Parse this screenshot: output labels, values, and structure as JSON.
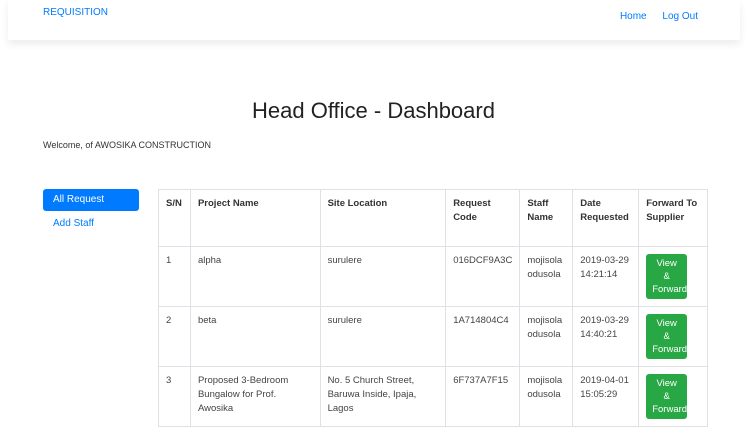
{
  "navbar": {
    "brand": "REQUISITION",
    "links": [
      "Home",
      "Log Out"
    ]
  },
  "page": {
    "title": "Head Office - Dashboard",
    "welcome": "Welcome, of AWOSIKA CONSTRUCTION"
  },
  "sidebar": {
    "items": [
      {
        "label": "All Request",
        "active": true
      },
      {
        "label": "Add Staff",
        "active": false
      }
    ]
  },
  "table": {
    "headers": [
      "S/N",
      "Project Name",
      "Site Location",
      "Request Code",
      "Staff Name",
      "Date Requested",
      "Forward To Supplier"
    ],
    "rows": [
      {
        "sn": "1",
        "project": "alpha",
        "site": "surulere",
        "code": "016DCF9A3C",
        "staff": "mojisola odusola",
        "date": "2019-03-29 14:21:14",
        "action": "View & Forward"
      },
      {
        "sn": "2",
        "project": "beta",
        "site": "surulere",
        "code": "1A714804C4",
        "staff": "mojisola odusola",
        "date": "2019-03-29 14:40:21",
        "action": "View & Forward"
      },
      {
        "sn": "3",
        "project": "Proposed 3-Bedroom Bungalow for Prof. Awosika",
        "site": "No. 5 Church Street, Baruwa Inside, Ipaja, Lagos",
        "code": "6F737A7F15",
        "staff": "mojisola odusola",
        "date": "2019-04-01 15:05:29",
        "action": "View & Forward"
      }
    ]
  },
  "colors": {
    "primary": "#007bff",
    "success": "#28a745",
    "border": "#dee2e6"
  }
}
